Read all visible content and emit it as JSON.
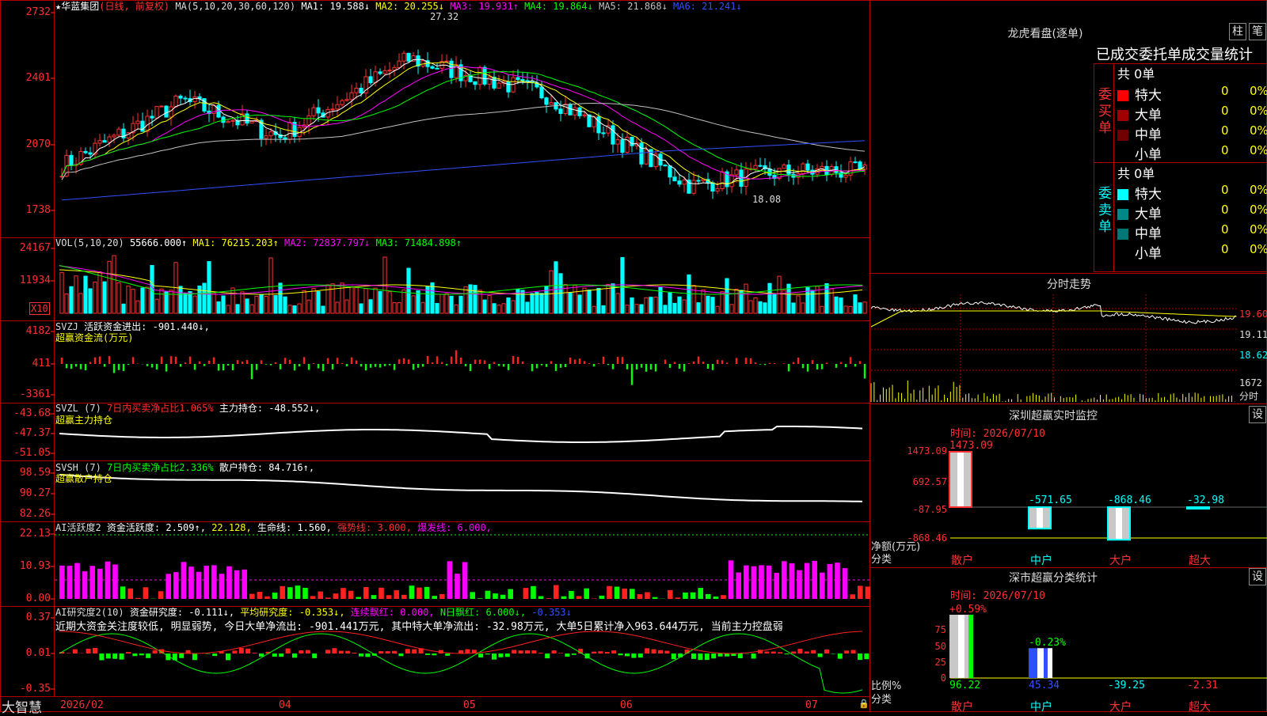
{
  "app_name": "大智慧",
  "stock": {
    "name": "华蓝集团",
    "mode": "(日线, 前复权)"
  },
  "price_panel": {
    "ma_label": "MA(5,10,20,30,60,120)",
    "ma": [
      {
        "key": "MA1",
        "text": "MA1: 19.588↓",
        "color": "#ffffff"
      },
      {
        "key": "MA2",
        "text": "MA2: 20.255↓",
        "color": "#ffff00"
      },
      {
        "key": "MA3",
        "text": "MA3: 19.931↑",
        "color": "#ff00ff"
      },
      {
        "key": "MA4",
        "text": "MA4: 19.864↓",
        "color": "#00ff00"
      },
      {
        "key": "MA5",
        "text": "MA5: 21.868↓",
        "color": "#c0c0c0"
      },
      {
        "key": "MA6",
        "text": "MA6: 21.241↓",
        "color": "#3050ff"
      }
    ],
    "y_labels": [
      "2732",
      "2401",
      "2070",
      "1738"
    ],
    "high_label": "27.32",
    "low_label": "18.08"
  },
  "vol_panel": {
    "label": "VOL(5,10,20)",
    "value": "55666.000↑",
    "ma": [
      {
        "text": "MA1: 76215.203↑",
        "color": "#ffff00"
      },
      {
        "text": "MA2: 72837.797↓",
        "color": "#ff00ff"
      },
      {
        "text": "MA3: 71484.898↑",
        "color": "#00ff00"
      }
    ],
    "y_labels": [
      "24167",
      "11934"
    ],
    "unit": "X10"
  },
  "svzj_panel": {
    "label": "SVZJ",
    "text": "活跃资金进出: -901.440↓,",
    "subtitle": "超赢资金流(万元)",
    "y_labels": [
      "4182",
      "411",
      "-3361"
    ]
  },
  "svzl_panel": {
    "label": "SVZL (7)",
    "ratio": "7日内买卖净占比1.065%",
    "text": "主力持仓: -48.552↓,",
    "subtitle": "超赢主力持仓",
    "y_labels": [
      "-43.68",
      "-47.37",
      "-51.05"
    ]
  },
  "svsh_panel": {
    "label": "SVSH (7)",
    "ratio": "7日内买卖净占比2.336%",
    "text": "散户持仓: 84.716↑,",
    "subtitle": "超赢散户持仓",
    "y_labels": [
      "98.59",
      "90.27",
      "82.26"
    ]
  },
  "ai_active_panel": {
    "label": "AI活跃度2",
    "text1": "资金活跃度: 2.509↑,",
    "text2": "22.128,",
    "text3": "生命线: 1.560,",
    "text4": "强势线: 3.000,",
    "text5": "爆发线: 6.000,",
    "y_labels": [
      "22.13",
      "10.93",
      "0.00"
    ]
  },
  "ai_research_panel": {
    "label": "AI研究度2(10)",
    "text1": "资金研究度: -0.111↓,",
    "text2": "平均研究度: -0.353↓,",
    "text3": "连续飘红: 0.000,",
    "text4": "N日飘红: 6.000↓,",
    "text5": "-0.353↓",
    "comment": "近期大资金关注度较低, 明显弱势, 今日大单净流出: -901.441万元, 其中特大单净流出: -32.98万元, 大单5日累计净入963.644万元, 当前主力控盘弱",
    "y_labels": [
      "0.37",
      "0.01",
      "-0.35"
    ]
  },
  "x_axis": [
    "2026/02",
    "04",
    "05",
    "06",
    "07"
  ],
  "dragon": {
    "title": "龙虎看盘(逐单)",
    "btn_col": "柱",
    "btn_pen": "笔",
    "tabs": "已成交委托单成交量统计",
    "buy": {
      "side": "委买单",
      "total": "共 0单",
      "rows": [
        {
          "name": "特大",
          "v": "0",
          "p": "0%",
          "color": "#ff0000"
        },
        {
          "name": "大单",
          "v": "0",
          "p": "0%",
          "color": "#a00000"
        },
        {
          "name": "中单",
          "v": "0",
          "p": "0%",
          "color": "#700000"
        },
        {
          "name": "小单",
          "v": "0",
          "p": "0%",
          "color": "#000000"
        }
      ]
    },
    "sell": {
      "side": "委卖单",
      "total": "共 0单",
      "rows": [
        {
          "name": "特大",
          "v": "0",
          "p": "0%",
          "color": "#00ffff"
        },
        {
          "name": "大单",
          "v": "0",
          "p": "0%",
          "color": "#008888"
        },
        {
          "name": "中单",
          "v": "0",
          "p": "0%",
          "color": "#007777"
        },
        {
          "name": "小单",
          "v": "0",
          "p": "0%",
          "color": "#000000"
        }
      ]
    }
  },
  "intraday": {
    "title": "分时走势",
    "labels": [
      "19.60",
      "19.11",
      "18.62",
      "1672",
      "分时"
    ]
  },
  "monitor": {
    "title": "深圳超赢实时监控",
    "btn": "设",
    "time": "时间: 2026/07/10",
    "y_labels": [
      "1473.09",
      "692.57",
      "-87.95",
      "-868.46"
    ],
    "bars": [
      {
        "cat": "散户",
        "value": "1473.09"
      },
      {
        "cat": "中户",
        "value": "-571.65"
      },
      {
        "cat": "大户",
        "value": "-868.46"
      },
      {
        "cat": "超大",
        "value": "-32.98"
      }
    ],
    "unit1": "净额(万元)",
    "unit2": "分类"
  },
  "classify": {
    "title": "深市超赢分类统计",
    "btn": "设",
    "time": "时间: 2026/07/10",
    "y_labels": [
      "75",
      "50",
      "25",
      "0"
    ],
    "bars": [
      {
        "cat": "散户",
        "top": "+0.59%",
        "bottom": "96.22"
      },
      {
        "cat": "中户",
        "top": "-0.23%",
        "bottom": "45.34"
      },
      {
        "cat": "大户",
        "top": "",
        "bottom": "-39.25"
      },
      {
        "cat": "超大",
        "top": "",
        "bottom": "-2.31"
      }
    ],
    "unit1": "比例%",
    "unit2": "分类"
  }
}
